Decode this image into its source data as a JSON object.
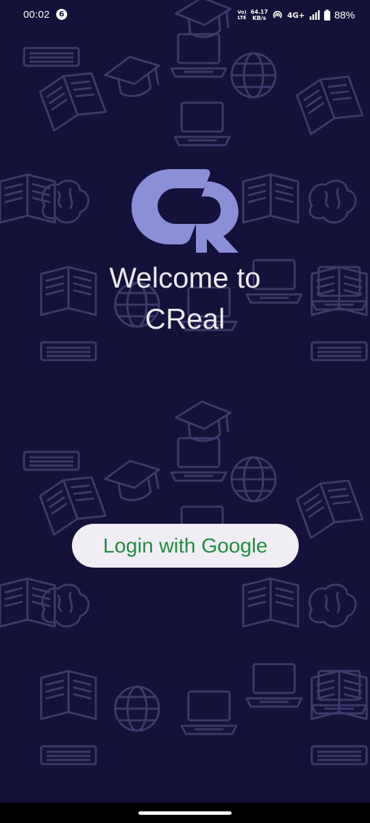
{
  "status_bar": {
    "time": "00:02",
    "notification_count": "6",
    "volte_line1": "Vo)",
    "volte_line2": "LTE",
    "speed_value": "64.17",
    "speed_unit": "KB/s",
    "network_type": "4G+",
    "battery_percent": "88%",
    "icons": [
      "hotspot-icon",
      "signal-icon",
      "battery-icon"
    ]
  },
  "app": {
    "logo_name": "creal-logo",
    "logo_color": "#8b8fd6",
    "welcome_line1": "Welcome to",
    "welcome_line2": "CReal",
    "background_color": "#14113a"
  },
  "login": {
    "label": "Login with Google",
    "text_color": "#1e8e3e",
    "background_color": "#f1edf5"
  }
}
